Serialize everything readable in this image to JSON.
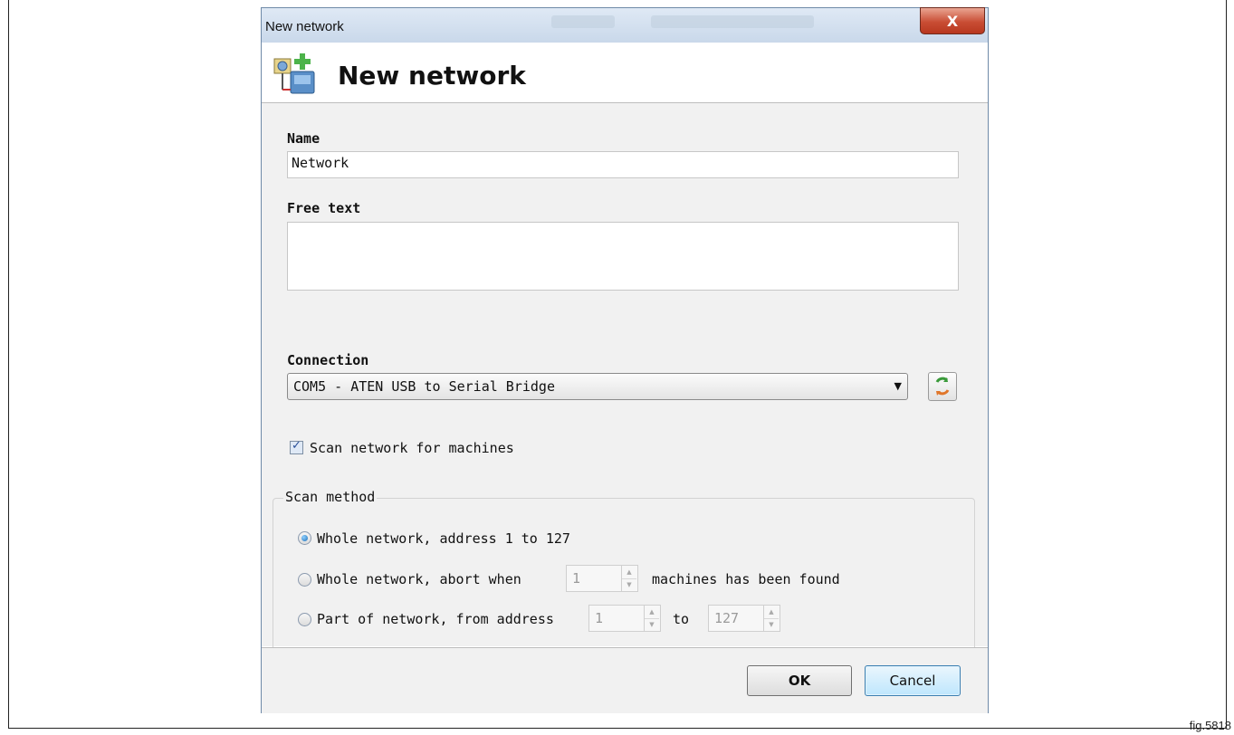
{
  "figure_label": "fig.5818",
  "window": {
    "title": "New network",
    "close_glyph": "X"
  },
  "header": {
    "title": "New network",
    "icon": "new-network-icon"
  },
  "form": {
    "name_label": "Name",
    "name_value": "Network",
    "free_text_label": "Free text",
    "free_text_value": "",
    "connection_label": "Connection",
    "connection_value": "COM5 - ATEN USB to Serial Bridge",
    "refresh_icon": "refresh-icon",
    "scan_checkbox_label": "Scan network for machines",
    "scan_checked": true
  },
  "scan_method": {
    "legend": "Scan method",
    "options": [
      {
        "label": "Whole network, address 1 to 127",
        "selected": true
      },
      {
        "label_before": "Whole network, abort when",
        "count": "1",
        "label_after": "machines has been found",
        "selected": false
      },
      {
        "label_before": "Part of network, from address",
        "from": "1",
        "to_label": "to",
        "to": "127",
        "selected": false
      }
    ]
  },
  "buttons": {
    "ok": "OK",
    "cancel": "Cancel"
  },
  "colors": {
    "close_button": "#c94d34",
    "titlebar": "#cfdced",
    "radio_selected": "#1f6fb8"
  }
}
